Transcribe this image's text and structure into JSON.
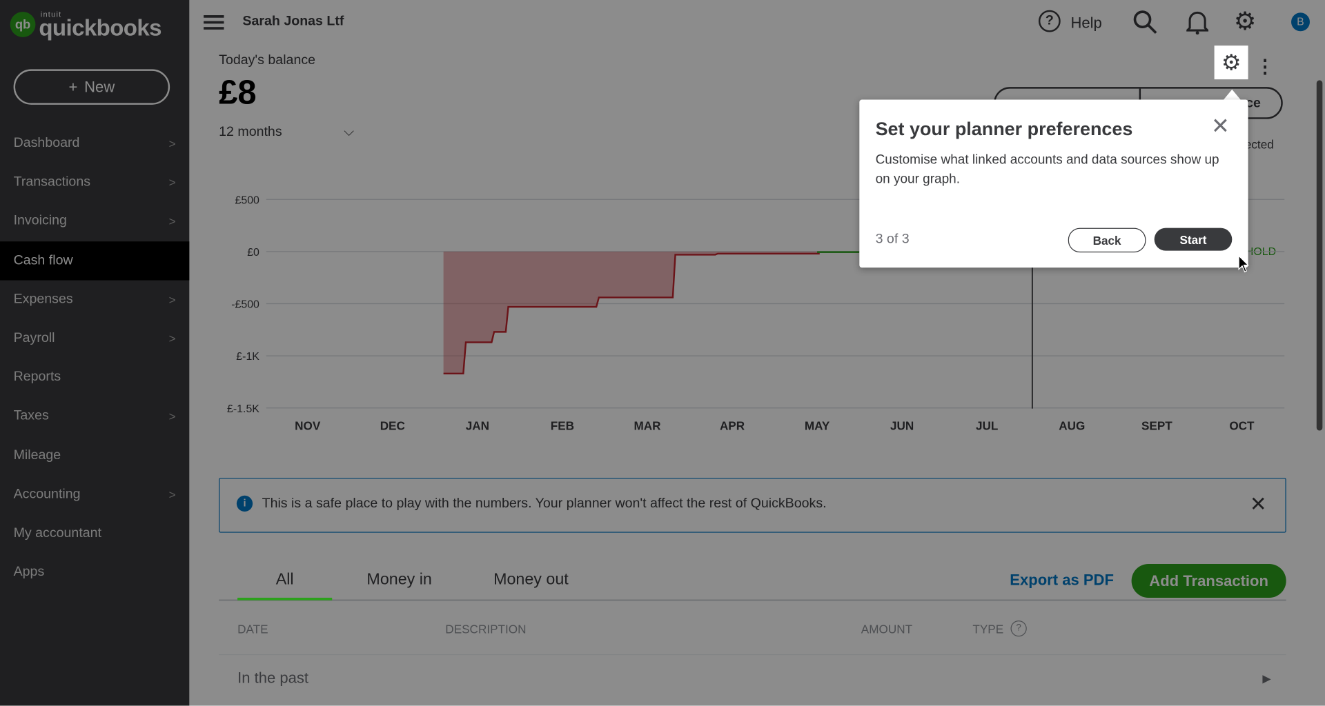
{
  "brand": {
    "logo_mark": "qb",
    "wordmark": "quickbooks",
    "intuit": "intuit",
    "accent": "#2ca01c"
  },
  "sidebar": {
    "new_label": "New",
    "items": [
      {
        "label": "Dashboard",
        "chevron": true
      },
      {
        "label": "Transactions",
        "chevron": true
      },
      {
        "label": "Invoicing",
        "chevron": true
      },
      {
        "label": "Cash flow",
        "chevron": false,
        "active": true
      },
      {
        "label": "Expenses",
        "chevron": true
      },
      {
        "label": "Payroll",
        "chevron": true
      },
      {
        "label": "Reports",
        "chevron": false
      },
      {
        "label": "Taxes",
        "chevron": true
      },
      {
        "label": "Mileage",
        "chevron": false
      },
      {
        "label": "Accounting",
        "chevron": true
      },
      {
        "label": "My accountant",
        "chevron": false
      },
      {
        "label": "Apps",
        "chevron": false
      }
    ]
  },
  "topbar": {
    "company": "Sarah Jonas Ltf",
    "help_label": "Help",
    "avatar_initial": "B",
    "avatar_color": "#0077c5"
  },
  "balance": {
    "label": "Today's balance",
    "value": "£8",
    "period": "12 months"
  },
  "hidden_fragments": {
    "toggle_right_fragment": "ce",
    "legend_fragment": "jected",
    "threshold_fragment": "HOLD"
  },
  "chart_data": {
    "type": "area",
    "x_ticks": [
      "NOV",
      "DEC",
      "JAN",
      "FEB",
      "MAR",
      "APR",
      "MAY",
      "JUN",
      "JUL",
      "AUG",
      "SEPT",
      "OCT"
    ],
    "y_ticks": [
      {
        "v": 500,
        "label": "£500"
      },
      {
        "v": 0,
        "label": "£0"
      },
      {
        "v": -500,
        "label": "-£500"
      },
      {
        "v": -1000,
        "label": "£-1K"
      },
      {
        "v": -1500,
        "label": "£-1.5K"
      }
    ],
    "ylim": [
      -1500,
      500
    ],
    "grid": true,
    "today": "Jul 17",
    "series": [
      {
        "color": "#c4262e",
        "points": [
          {
            "date": "Dec 19",
            "value": -1170
          },
          {
            "date": "Dec 26",
            "value": -870
          },
          {
            "date": "Jan 6",
            "value": -770
          },
          {
            "date": "Jan 11",
            "value": -530
          },
          {
            "date": "Feb 13",
            "value": -440
          },
          {
            "date": "Mar 10",
            "value": -30
          },
          {
            "date": "Mar 25",
            "value": -20
          },
          {
            "date": "May 1",
            "value": -20
          }
        ]
      },
      {
        "color": "#2ca01c",
        "points": [
          {
            "date": "May 1",
            "value": -5
          },
          {
            "date": "May 15",
            "value": -5
          }
        ]
      }
    ]
  },
  "banner": {
    "text": "This is a safe place to play with the numbers. Your planner won't affect the rest of QuickBooks."
  },
  "tabs": [
    {
      "label": "All",
      "active": true
    },
    {
      "label": "Money in"
    },
    {
      "label": "Money out"
    }
  ],
  "actions": {
    "export": "Export as PDF",
    "add": "Add Transaction"
  },
  "table": {
    "columns": [
      "DATE",
      "DESCRIPTION",
      "AMOUNT",
      "TYPE"
    ],
    "group": "In the past"
  },
  "popup": {
    "title": "Set your planner preferences",
    "body": "Customise what linked accounts and data sources show up on your graph.",
    "step": "3 of 3",
    "back": "Back",
    "start": "Start"
  }
}
